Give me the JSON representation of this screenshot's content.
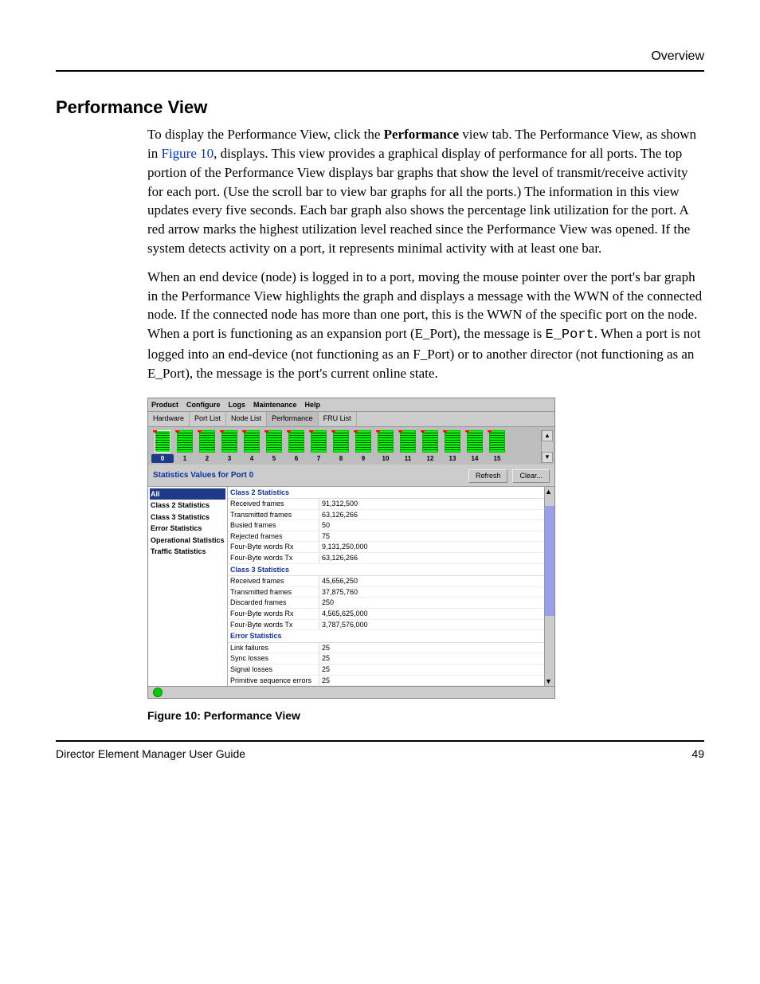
{
  "header": {
    "section": "Overview"
  },
  "section": {
    "title": "Performance View"
  },
  "para1_a": "To display the Performance View, click the ",
  "para1_b": "Performance",
  "para1_c": " view tab. The Performance View, as shown in ",
  "para1_link": "Figure 10",
  "para1_d": ", displays. This view provides a graphical display of performance for all ports. The top portion of the Performance View displays bar graphs that show the level of transmit/receive activity for each port. (Use the scroll bar to view bar graphs for all the ports.) The information in this view updates every five seconds. Each bar graph also shows the percentage link utilization for the port. A red arrow marks the highest utilization level reached since the Performance View was opened. If the system detects activity on a port, it represents minimal activity with at least one bar.",
  "para2_a": "When an end device (node) is logged in to a port, moving the mouse pointer over the port's bar graph in the Performance View highlights the graph and displays a message with the WWN of the connected node. If the connected node has more than one port, this is the WWN of the specific port on the node. When a port is functioning as an expansion port (E_Port), the message is ",
  "para2_mono": "E_Port",
  "para2_b": ". When a port is not logged into an end-device (not functioning as an F_Port) or to another director (not functioning as an E_Port), the message is the port's current online state.",
  "app": {
    "menu": [
      "Product",
      "Configure",
      "Logs",
      "Maintenance",
      "Help"
    ],
    "tabs": [
      "Hardware",
      "Port List",
      "Node List",
      "Performance",
      "FRU List"
    ],
    "active_tab": 3,
    "ports": [
      0,
      1,
      2,
      3,
      4,
      5,
      6,
      7,
      8,
      9,
      10,
      11,
      12,
      13,
      14,
      15
    ],
    "stats_title": "Statistics Values for Port 0",
    "refresh": "Refresh",
    "clear": "Clear...",
    "left": [
      "All",
      "Class 2 Statistics",
      "Class 3 Statistics",
      "Error Statistics",
      "Operational Statistics",
      "Traffic Statistics"
    ],
    "sections": [
      {
        "title": "Class 2 Statistics",
        "rows": [
          [
            "Received frames",
            "91,312,500"
          ],
          [
            "Transmitted frames",
            "63,126,266"
          ],
          [
            "Busied frames",
            "50"
          ],
          [
            "Rejected frames",
            "75"
          ],
          [
            "Four-Byte words Rx",
            "9,131,250,000"
          ],
          [
            "Four-Byte words Tx",
            "63,126,266"
          ]
        ]
      },
      {
        "title": "Class 3 Statistics",
        "rows": [
          [
            "Received frames",
            "45,656,250"
          ],
          [
            "Transmitted frames",
            "37,875,760"
          ],
          [
            "Discarded frames",
            "250"
          ],
          [
            "Four-Byte words Rx",
            "4,565,625,000"
          ],
          [
            "Four-Byte words Tx",
            "3,787,576,000"
          ]
        ]
      },
      {
        "title": "Error Statistics",
        "rows": [
          [
            "Link failures",
            "25"
          ],
          [
            "Sync losses",
            "25"
          ],
          [
            "Signal losses",
            "25"
          ],
          [
            "Primitive sequence errors",
            "25"
          ]
        ]
      }
    ]
  },
  "figure_caption": "Figure 10:  Performance View",
  "footer": {
    "left": "Director Element Manager User Guide",
    "right": "49"
  }
}
